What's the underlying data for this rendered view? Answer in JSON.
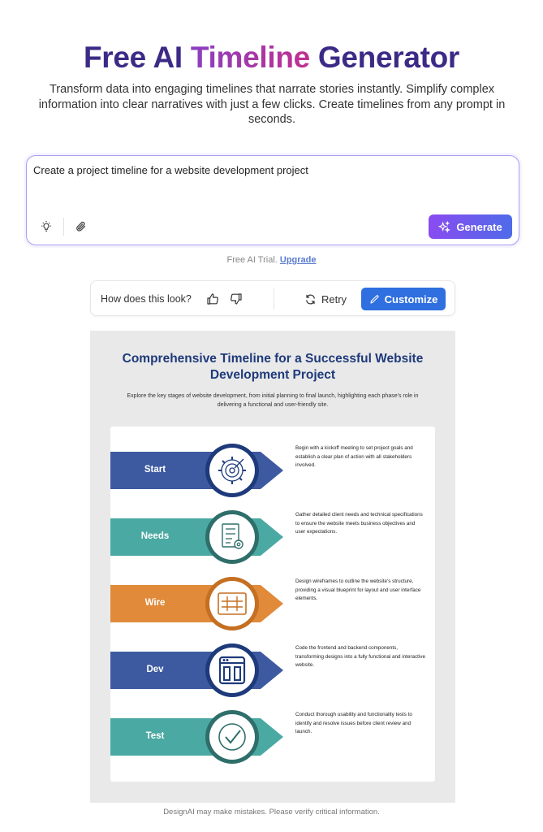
{
  "hero": {
    "title_part1": "Free AI ",
    "title_part2": "Timeline",
    "title_part3": " Generator",
    "subtitle": "Transform data into engaging timelines that narrate stories instantly. Simplify complex information into clear narratives with just a few clicks. Create timelines from any prompt in seconds."
  },
  "prompt": {
    "text": "Create a project timeline for a website development project",
    "generate_label": "Generate"
  },
  "trial": {
    "text": "Free AI Trial.",
    "link": "Upgrade"
  },
  "feedback": {
    "question": "How does this look?",
    "retry_label": "Retry",
    "customize_label": "Customize"
  },
  "infographic": {
    "title": "Comprehensive Timeline for a Successful Website Development Project",
    "subtitle": "Explore the key stages of website development, from initial planning to final launch, highlighting each phase's role in delivering a functional and user-friendly site.",
    "steps": [
      {
        "label": "Start",
        "color": "#3d5aa1",
        "ring": "#1e3a7b",
        "icon": "gear-target-icon",
        "desc": "Begin with a kickoff meeting to set project goals and establish a clear plan of action with all stakeholders involved."
      },
      {
        "label": "Needs",
        "color": "#4aa9a3",
        "ring": "#2f6e6a",
        "icon": "checklist-gear-icon",
        "desc": "Gather detailed client needs and technical specifications to ensure the website meets business objectives and user expectations."
      },
      {
        "label": "Wire",
        "color": "#e08a3a",
        "ring": "#c46f22",
        "icon": "wireframe-grid-icon",
        "desc": "Design wireframes to outline the website's structure, providing a visual blueprint for layout and user interface elements."
      },
      {
        "label": "Dev",
        "color": "#3d5aa1",
        "ring": "#1e3a7b",
        "icon": "browser-window-icon",
        "desc": "Code the frontend and backend components, transforming designs into a fully functional and interactive website."
      },
      {
        "label": "Test",
        "color": "#4aa9a3",
        "ring": "#2f6e6a",
        "icon": "check-circle-icon",
        "desc": "Conduct thorough usability and functionality tests to identify and resolve issues before client review and launch."
      }
    ]
  },
  "footer": {
    "text": "DesignAI may make mistakes. Please verify critical information."
  }
}
